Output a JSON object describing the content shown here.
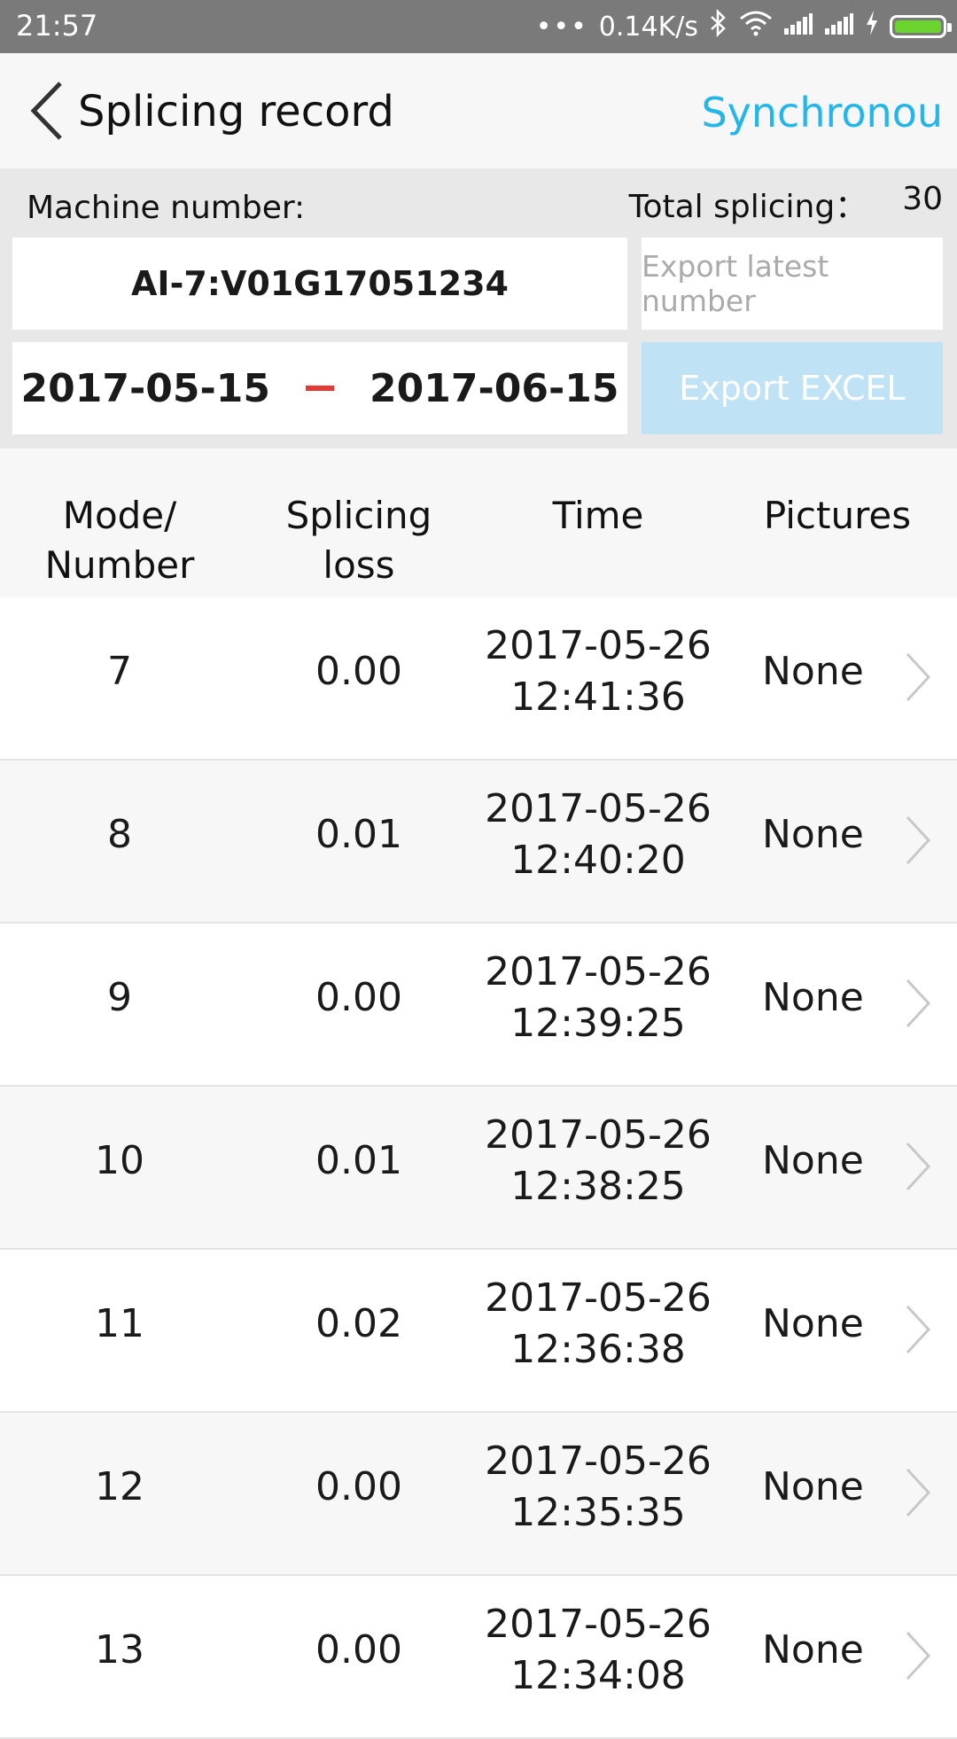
{
  "status_bar": {
    "time": "21:57",
    "network_speed": "0.14K/s",
    "icons": [
      "more-dots-icon",
      "bluetooth-icon",
      "wifi-icon",
      "signal-icon",
      "signal-icon",
      "charging-icon",
      "battery-icon"
    ],
    "battery_color": "#6bd42f"
  },
  "header": {
    "title": "Splicing record",
    "sync_label": "Synchronou",
    "accent": "#23b6ea"
  },
  "filters": {
    "machine_label": "Machine number:",
    "total_label": "Total splicing：",
    "total_value": "30",
    "machine_value": "AI-7:V01G17051234",
    "export_latest_placeholder": "Export latest number",
    "date_from": "2017-05-15",
    "date_to": "2017-06-15",
    "export_excel_label": "Export EXCEL"
  },
  "table": {
    "headers": {
      "mode_line1": "Mode/",
      "mode_line2": "Number",
      "loss_line1": "Splicing",
      "loss_line2": "loss",
      "time": "Time",
      "pictures": "Pictures"
    },
    "rows": [
      {
        "number": "7",
        "loss": "0.00",
        "date": "2017-05-26",
        "time": "12:41:36",
        "pictures": "None"
      },
      {
        "number": "8",
        "loss": "0.01",
        "date": "2017-05-26",
        "time": "12:40:20",
        "pictures": "None"
      },
      {
        "number": "9",
        "loss": "0.00",
        "date": "2017-05-26",
        "time": "12:39:25",
        "pictures": "None"
      },
      {
        "number": "10",
        "loss": "0.01",
        "date": "2017-05-26",
        "time": "12:38:25",
        "pictures": "None"
      },
      {
        "number": "11",
        "loss": "0.02",
        "date": "2017-05-26",
        "time": "12:36:38",
        "pictures": "None"
      },
      {
        "number": "12",
        "loss": "0.00",
        "date": "2017-05-26",
        "time": "12:35:35",
        "pictures": "None"
      },
      {
        "number": "13",
        "loss": "0.00",
        "date": "2017-05-26",
        "time": "12:34:08",
        "pictures": "None"
      }
    ]
  }
}
